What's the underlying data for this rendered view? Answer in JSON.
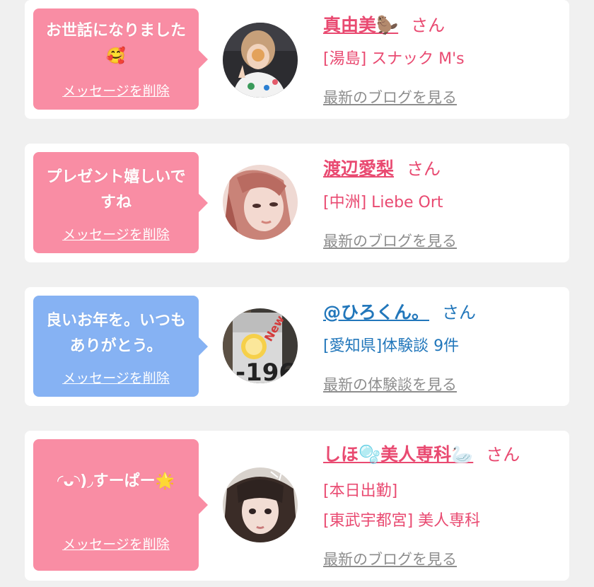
{
  "items": [
    {
      "message": "お世話になりました🥰",
      "delete_label": "メッセージを削除",
      "name": "真由美🦫",
      "honorific": "さん",
      "lines": [
        "[湯島] スナック M's"
      ],
      "more_label": "最新のブログを見る",
      "bubble_color": "#f98da4",
      "text_color": "#e94a71"
    },
    {
      "message": "プレゼント嬉しいですね",
      "delete_label": "メッセージを削除",
      "name": "渡辺愛梨",
      "honorific": "さん",
      "lines": [
        "[中洲] Liebe Ort"
      ],
      "more_label": "最新のブログを見る",
      "bubble_color": "#f98da4",
      "text_color": "#e94a71"
    },
    {
      "message": "良いお年を。いつもありがとう。",
      "delete_label": "メッセージを削除",
      "name": "@ひろくん。",
      "honorific": "さん",
      "lines": [
        "[愛知県]体験談 9件"
      ],
      "more_label": "最新の体験談を見る",
      "bubble_color": "#86b2f3",
      "text_color": "#2277bb"
    },
    {
      "message": "◜ᴗ◝)◞すーぱー🌟",
      "delete_label": "メッセージを削除",
      "name": "しほ🫧美人専科🦢",
      "honorific": "さん",
      "lines": [
        "[本日出勤]",
        "[東武宇都宮] 美人専科"
      ],
      "more_label": "最新のブログを見る",
      "bubble_color": "#f98da4",
      "text_color": "#e94a71"
    }
  ],
  "icons": {
    "avatar_1": "avatar-photo",
    "avatar_2": "avatar-photo",
    "avatar_3": "avatar-photo",
    "avatar_4": "avatar-photo"
  }
}
